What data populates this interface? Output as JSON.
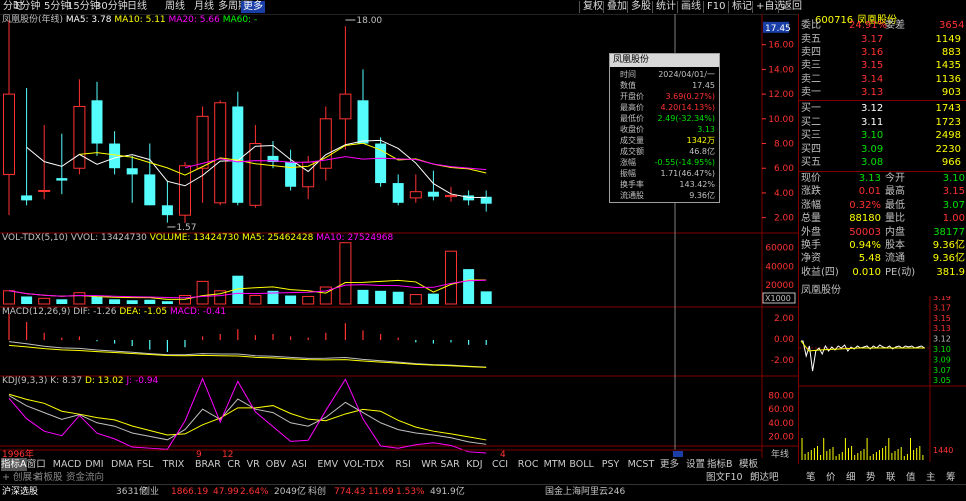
{
  "toolbar": {
    "periods": [
      "分时",
      "1分钟",
      "5分钟",
      "15分钟",
      "30分钟",
      "日线",
      "周线",
      "月线",
      "多周期",
      "更多"
    ],
    "active_index": 9,
    "right_items": [
      "复权",
      "叠加",
      "多股",
      "统计",
      "画线",
      "F10",
      "标记",
      "+自选",
      "返回"
    ]
  },
  "main_chart": {
    "title": "凤凰股份(年线)",
    "ma_legend": [
      {
        "label": "MA5: 3.78",
        "color": "#ffffff"
      },
      {
        "label": "MA10: 5.11",
        "color": "#ffff00"
      },
      {
        "label": "MA20: 5.66",
        "color": "#ff00ff"
      },
      {
        "label": "MA60: -",
        "color": "#00ff00"
      }
    ],
    "price_axis": [
      "16.00",
      "14.00",
      "12.00",
      "10.00",
      "8.00",
      "6.00",
      "4.00",
      "2.00"
    ],
    "current_price_label": "17.45",
    "high_label": "18.00",
    "low_label": "1.57",
    "colors": {
      "up": "#ff3232",
      "down": "#54fcfc",
      "axis": "#ff3232"
    }
  },
  "volume_panel": {
    "title": "VOL-TDX(5,10)",
    "legend": [
      {
        "label": "VVOL: 13424730",
        "color": "#c0c0c0"
      },
      {
        "label": "VOLUME: 13424730",
        "color": "#ffff00"
      },
      {
        "label": "MA5: 25462428",
        "color": "#ffff00"
      },
      {
        "label": "MA10: 27524968",
        "color": "#ff00ff"
      }
    ],
    "axis": [
      "60000",
      "40000",
      "20000"
    ],
    "unit": "X1000"
  },
  "macd_panel": {
    "title": "MACD(12,26,9)",
    "legend": [
      {
        "label": "DIF: -1.26",
        "color": "#c0c0c0"
      },
      {
        "label": "DEA: -1.05",
        "color": "#ffff00"
      },
      {
        "label": "MACD: -0.41",
        "color": "#ff00ff"
      }
    ],
    "axis": [
      "2.00",
      "0.00",
      "-2.00"
    ]
  },
  "kdj_panel": {
    "title": "KDJ(9,3,3)",
    "legend": [
      {
        "label": "K: 8.37",
        "color": "#c0c0c0"
      },
      {
        "label": "D: 13.02",
        "color": "#ffff00"
      },
      {
        "label": "J: -0.94",
        "color": "#ff00ff"
      }
    ],
    "axis": [
      "80.00",
      "60.00",
      "40.00",
      "20.00"
    ]
  },
  "time_axis": {
    "labels": [
      "1996年",
      "9",
      "12",
      "4"
    ],
    "right": "年线"
  },
  "infobox": {
    "title": "凤凰股份",
    "rows": [
      {
        "k": "时间",
        "v": "2024/04/01/一",
        "c": "#c0c0c0"
      },
      {
        "k": "数值",
        "v": "17.45",
        "c": "#c0c0c0"
      },
      {
        "k": "开盘价",
        "v": "3.69(0.27%)",
        "c": "#ff3232"
      },
      {
        "k": "最高价",
        "v": "4.20(14.13%)",
        "c": "#ff3232"
      },
      {
        "k": "最低价",
        "v": "2.49(-32.34%)",
        "c": "#00e000"
      },
      {
        "k": "收盘价",
        "v": "3.13",
        "c": "#00e000"
      },
      {
        "k": "成交量",
        "v": "1342万",
        "c": "#ffff00"
      },
      {
        "k": "成交额",
        "v": "46.8亿",
        "c": "#c0c0c0"
      },
      {
        "k": "涨幅",
        "v": "-0.55(-14.95%)",
        "c": "#00e000"
      },
      {
        "k": "振幅",
        "v": "1.71(46.47%)",
        "c": "#c0c0c0"
      },
      {
        "k": "换手率",
        "v": "143.42%",
        "c": "#c0c0c0"
      },
      {
        "k": "流通股",
        "v": "9.36亿",
        "c": "#c0c0c0"
      }
    ]
  },
  "right_panel": {
    "code": "600716",
    "name": "凤凰股份",
    "weibi_label": "委比",
    "weibi_value": "24.91%",
    "weicha_label": "委差",
    "weicha_value": "3654",
    "sells": [
      {
        "label": "卖五",
        "price": "3.17",
        "vol": "1149"
      },
      {
        "label": "卖四",
        "price": "3.16",
        "vol": "883"
      },
      {
        "label": "卖三",
        "price": "3.15",
        "vol": "1435"
      },
      {
        "label": "卖二",
        "price": "3.14",
        "vol": "1136"
      },
      {
        "label": "卖一",
        "price": "3.13",
        "vol": "903"
      }
    ],
    "buys": [
      {
        "label": "买一",
        "price": "3.12",
        "vol": "1743"
      },
      {
        "label": "买二",
        "price": "3.11",
        "vol": "1723"
      },
      {
        "label": "买三",
        "price": "3.10",
        "vol": "2498"
      },
      {
        "label": "买四",
        "price": "3.09",
        "vol": "2230"
      },
      {
        "label": "买五",
        "price": "3.08",
        "vol": "966"
      }
    ],
    "quotes": [
      {
        "l1": "现价",
        "v1": "3.13",
        "c1": "#00e000",
        "l2": "今开",
        "v2": "3.10",
        "c2": "#00e000"
      },
      {
        "l1": "涨跌",
        "v1": "0.01",
        "c1": "#ff3232",
        "l2": "最高",
        "v2": "3.15",
        "c2": "#ff3232"
      },
      {
        "l1": "涨幅",
        "v1": "0.32%",
        "c1": "#ff3232",
        "l2": "最低",
        "v2": "3.07",
        "c2": "#00e000"
      },
      {
        "l1": "总量",
        "v1": "88180",
        "c1": "#ffff00",
        "l2": "量比",
        "v2": "1.00",
        "c2": "#ff3232"
      },
      {
        "l1": "外盘",
        "v1": "50003",
        "c1": "#ff3232",
        "l2": "内盘",
        "v2": "38177",
        "c2": "#00e000"
      },
      {
        "l1": "换手",
        "v1": "0.94%",
        "c1": "#ffff00",
        "l2": "股本",
        "v2": "9.36亿",
        "c2": "#ffff00"
      },
      {
        "l1": "净资",
        "v1": "5.48",
        "c1": "#ffff00",
        "l2": "流通",
        "v2": "9.36亿",
        "c2": "#ffff00"
      },
      {
        "l1": "收益(四)",
        "v1": "0.010",
        "c1": "#ffff00",
        "l2": "PE(动)",
        "v2": "381.9",
        "c2": "#ffff00"
      }
    ],
    "mini_title": "凤凰股份",
    "mini_axis": [
      "3.19",
      "3.17",
      "3.15",
      "3.13",
      "3.12",
      "3.10",
      "3.09",
      "3.07",
      "3.05"
    ],
    "mini_price_now": "3.12",
    "mini_vol_axis": [
      "1440"
    ],
    "mini_tabs": [
      "笔",
      "价",
      "细",
      "势",
      "联",
      "值",
      "主",
      "筹"
    ]
  },
  "tabs": [
    "指标A",
    "窗口",
    "MACD",
    "DMI",
    "DMA",
    "FSL",
    "TRIX",
    "BRAR",
    "CR",
    "VR",
    "OBV",
    "ASI",
    "EMV",
    "VOL-TDX",
    "RSI",
    "WR",
    "SAR",
    "KDJ",
    "CCI",
    "ROC",
    "MTM",
    "BOLL",
    "PSY",
    "MCST",
    "更多",
    "设置"
  ],
  "tabs_right": [
    "指标B",
    "模板"
  ],
  "tab2_left": [
    "+ 创展>",
    "首板股",
    "资金流向"
  ],
  "tab2_right": [
    "图文F10",
    "朗达吧"
  ],
  "statusbar": {
    "items": [
      {
        "t": "沪深选股",
        "c": "#ffffff"
      },
      {
        "t": "3631亿",
        "c": "#c0c0c0"
      },
      {
        "t": "创业",
        "c": "#c0c0c0"
      },
      {
        "t": "1866.19",
        "c": "#ff3232"
      },
      {
        "t": "47.99",
        "c": "#ff3232"
      },
      {
        "t": "2.64%",
        "c": "#ff3232"
      },
      {
        "t": "2049亿",
        "c": "#c0c0c0"
      },
      {
        "t": "科创",
        "c": "#c0c0c0"
      },
      {
        "t": "774.43",
        "c": "#ff3232"
      },
      {
        "t": "11.69",
        "c": "#ff3232"
      },
      {
        "t": "1.53%",
        "c": "#ff3232"
      },
      {
        "t": "491.9亿",
        "c": "#c0c0c0"
      },
      {
        "t": "国金上海阿里云246",
        "c": "#c0c0c0"
      }
    ]
  },
  "chart_data": {
    "type": "candlestick",
    "price_ylim": [
      1,
      18
    ],
    "candles": [
      {
        "o": 5.5,
        "h": 18,
        "l": 2.2,
        "c": 12.0
      },
      {
        "o": 3.8,
        "h": 12.5,
        "l": 3.0,
        "c": 3.4
      },
      {
        "o": 4.2,
        "h": 9.5,
        "l": 3.5,
        "c": 4.2
      },
      {
        "o": 5.2,
        "h": 8.8,
        "l": 3.9,
        "c": 5.0
      },
      {
        "o": 6.0,
        "h": 13.2,
        "l": 5.5,
        "c": 11.0
      },
      {
        "o": 11.5,
        "h": 13.0,
        "l": 7.0,
        "c": 8.0
      },
      {
        "o": 8.0,
        "h": 9.0,
        "l": 5.5,
        "c": 6.0
      },
      {
        "o": 6.0,
        "h": 7.0,
        "l": 3.2,
        "c": 5.5
      },
      {
        "o": 5.5,
        "h": 8.0,
        "l": 3.0,
        "c": 3.0
      },
      {
        "o": 3.0,
        "h": 5.0,
        "l": 1.6,
        "c": 2.2
      },
      {
        "o": 2.2,
        "h": 6.5,
        "l": 1.57,
        "c": 6.2
      },
      {
        "o": 6.0,
        "h": 11.0,
        "l": 3.2,
        "c": 10.2
      },
      {
        "o": 3.2,
        "h": 11.5,
        "l": 3.0,
        "c": 11.3
      },
      {
        "o": 11.0,
        "h": 12.2,
        "l": 3.0,
        "c": 3.2
      },
      {
        "o": 3.0,
        "h": 9.5,
        "l": 2.8,
        "c": 8.0
      },
      {
        "o": 7.0,
        "h": 8.2,
        "l": 6.0,
        "c": 6.5
      },
      {
        "o": 6.5,
        "h": 7.5,
        "l": 4.2,
        "c": 4.5
      },
      {
        "o": 4.5,
        "h": 7.0,
        "l": 3.5,
        "c": 6.5
      },
      {
        "o": 6.0,
        "h": 11.0,
        "l": 5.0,
        "c": 10.0
      },
      {
        "o": 10.0,
        "h": 17.5,
        "l": 7.5,
        "c": 12.0
      },
      {
        "o": 11.5,
        "h": 14.0,
        "l": 8.0,
        "c": 8.0
      },
      {
        "o": 8.0,
        "h": 8.5,
        "l": 4.5,
        "c": 4.8
      },
      {
        "o": 4.8,
        "h": 5.5,
        "l": 3.0,
        "c": 3.2
      },
      {
        "o": 3.6,
        "h": 5.5,
        "l": 3.2,
        "c": 4.1
      },
      {
        "o": 4.1,
        "h": 5.8,
        "l": 3.4,
        "c": 3.7
      },
      {
        "o": 3.7,
        "h": 4.5,
        "l": 3.3,
        "c": 3.8
      },
      {
        "o": 3.8,
        "h": 4.2,
        "l": 3.0,
        "c": 3.4
      },
      {
        "o": 3.69,
        "h": 4.2,
        "l": 2.49,
        "c": 3.13
      }
    ],
    "volumes": [
      14000,
      8000,
      6000,
      5000,
      12000,
      8000,
      5000,
      4000,
      4500,
      3000,
      9000,
      24000,
      14000,
      30000,
      9000,
      14000,
      9000,
      8000,
      18000,
      65000,
      15000,
      14000,
      13000,
      10000,
      11000,
      56000,
      37000,
      13424
    ],
    "macd": [
      2.2,
      1.5,
      0.6,
      0.2,
      0.3,
      -0.1,
      -0.3,
      -0.5,
      -0.8,
      -1.0,
      -0.6,
      0.3,
      0.5,
      0.9,
      0.4,
      0.5,
      0.3,
      0.2,
      0.6,
      1.4,
      0.8,
      0.5,
      0.2,
      -0.2,
      -0.3,
      -0.2,
      -0.4,
      -0.41
    ],
    "k_values": [
      80,
      65,
      55,
      45,
      52,
      40,
      35,
      25,
      20,
      15,
      30,
      60,
      45,
      75,
      60,
      55,
      40,
      35,
      48,
      70,
      55,
      40,
      30,
      25,
      22,
      18,
      12,
      8.37
    ]
  }
}
